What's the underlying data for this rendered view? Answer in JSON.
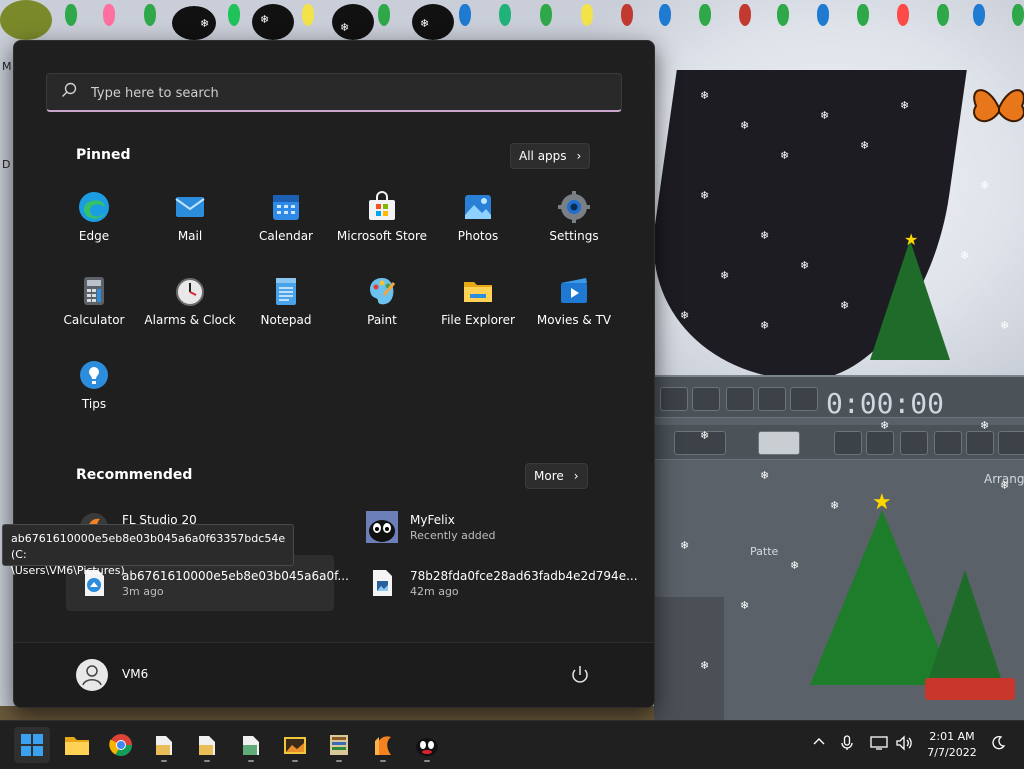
{
  "search": {
    "placeholder": "Type here to search"
  },
  "pinned": {
    "title": "Pinned",
    "all_apps_label": "All apps",
    "apps": [
      {
        "label": "Edge",
        "icon": "edge-icon"
      },
      {
        "label": "Mail",
        "icon": "mail-icon"
      },
      {
        "label": "Calendar",
        "icon": "calendar-icon"
      },
      {
        "label": "Microsoft Store",
        "icon": "store-icon"
      },
      {
        "label": "Photos",
        "icon": "photos-icon"
      },
      {
        "label": "Settings",
        "icon": "gear-icon"
      },
      {
        "label": "Calculator",
        "icon": "calculator-icon"
      },
      {
        "label": "Alarms & Clock",
        "icon": "clock-icon"
      },
      {
        "label": "Notepad",
        "icon": "notepad-icon"
      },
      {
        "label": "Paint",
        "icon": "paint-icon"
      },
      {
        "label": "File Explorer",
        "icon": "folder-icon"
      },
      {
        "label": "Movies & TV",
        "icon": "movies-icon"
      },
      {
        "label": "Tips",
        "icon": "tips-icon"
      }
    ]
  },
  "recommended": {
    "title": "Recommended",
    "more_label": "More",
    "items": [
      {
        "name": "FL Studio 20",
        "sub": "",
        "icon": "fl-studio-icon"
      },
      {
        "name": "MyFelix",
        "sub": "Recently added",
        "icon": "felix-icon"
      },
      {
        "name": "ab6761610000e5eb8e03b045a6a0f...",
        "sub": "3m ago",
        "icon": "image-file-icon"
      },
      {
        "name": "78b28fda0fce28ad63fadb4e2d794e...",
        "sub": "42m ago",
        "icon": "image-file-icon"
      }
    ]
  },
  "tooltip": {
    "line1": "ab6761610000e5eb8e03b045a6a0f63357bdc54e (C:",
    "line2": "\\Users\\VM6\\Pictures)"
  },
  "user": {
    "name": "VM6"
  },
  "app_window": {
    "time": "0:00:00",
    "arrange": "Arrang",
    "pattern": "Patte"
  },
  "taskbar": {
    "items": [
      "windows-start-icon",
      "file-explorer-icon",
      "chrome-icon",
      "file-icon",
      "file-icon",
      "file-icon",
      "image-viewer-icon",
      "archive-icon",
      "fl-studio-icon",
      "felix-icon"
    ]
  },
  "clock": {
    "time": "2:01 AM",
    "date": "7/7/2022"
  },
  "colors": {
    "menu_bg": "#1f1f1f",
    "taskbar_bg": "#202020",
    "search_underline": "#c9a5cc",
    "accent_blue": "#0078d4"
  }
}
